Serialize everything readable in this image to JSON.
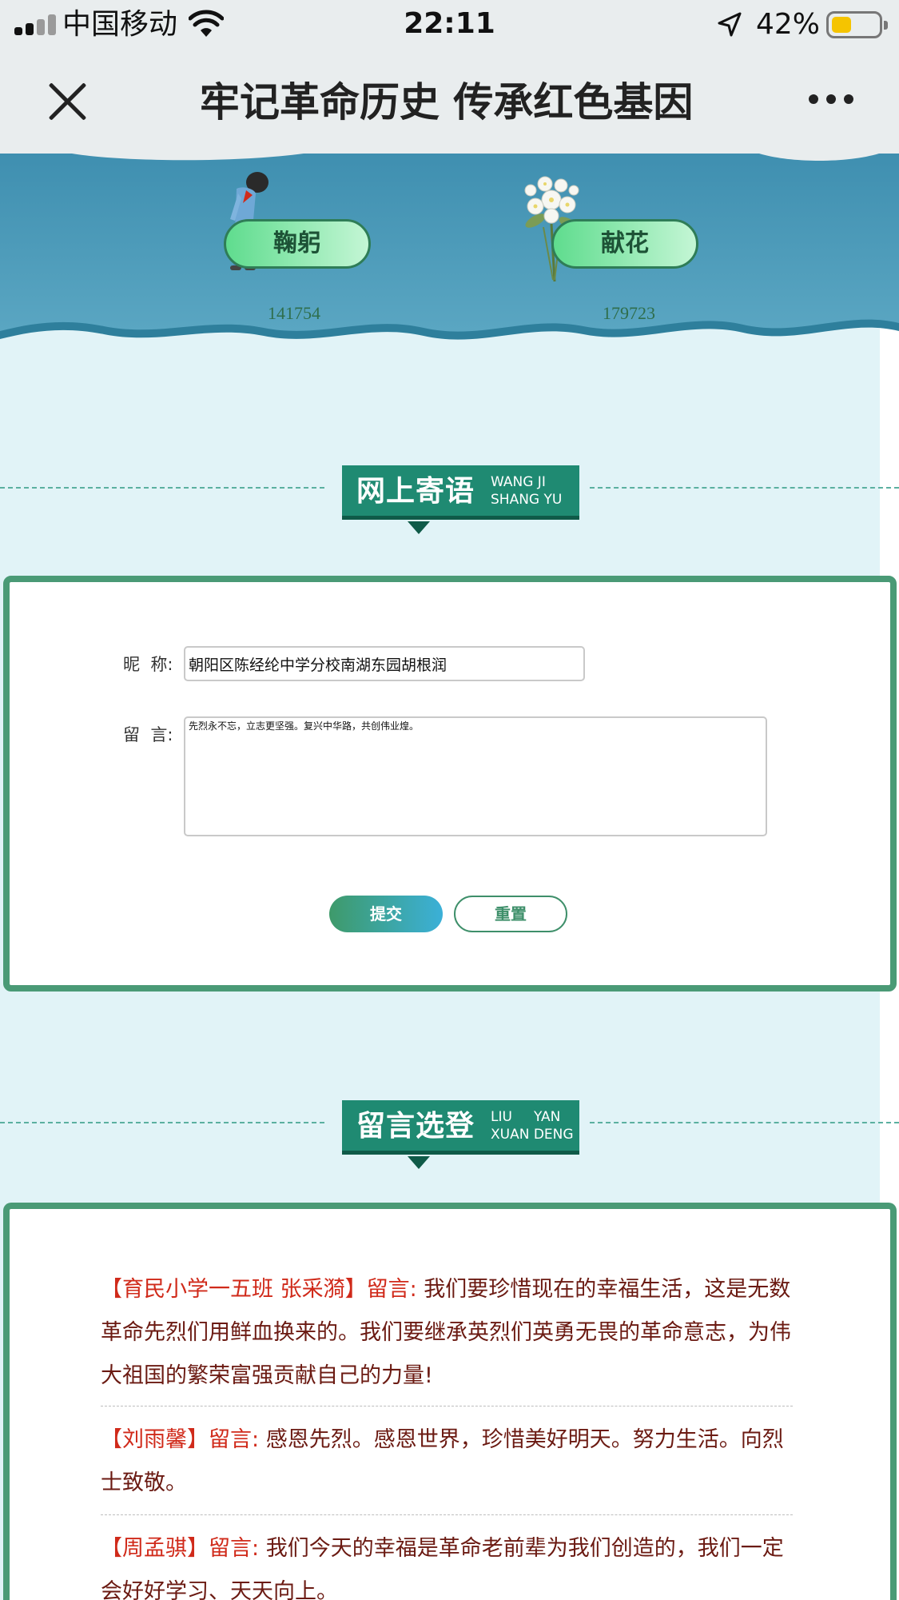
{
  "status_bar": {
    "carrier": "中国移动",
    "time": "22:11",
    "battery_percent": "42%",
    "battery_level": 0.42
  },
  "nav": {
    "title": "牢记革命历史 传承红色基因"
  },
  "memorial": {
    "bow": {
      "label": "鞠躬",
      "count": "141754"
    },
    "flower": {
      "label": "献花",
      "count": "179723"
    }
  },
  "guestbook_header": {
    "title_cn": "网上寄语",
    "pinyin_line1": "WANG JI",
    "pinyin_line2": "SHANG YU"
  },
  "form": {
    "nickname_label": "昵  称:",
    "nickname_value": "朝阳区陈经纶中学分校南湖东园胡根润",
    "message_label": "留  言:",
    "message_value": "先烈永不忘，立志更坚强。复兴中华路，共创伟业煌。",
    "submit_label": "提交",
    "reset_label": "重置"
  },
  "selected_header": {
    "title_cn": "留言选登",
    "pinyin_line1": "LIU     YAN",
    "pinyin_line2": "XUAN DENG"
  },
  "messages": [
    {
      "author": "【育民小学一五班 张采漪】留言:",
      "text": " 我们要珍惜现在的幸福生活，这是无数革命先烈们用鲜血换来的。我们要继承英烈们英勇无畏的革命意志，为伟大祖国的繁荣富强贡献自己的力量!"
    },
    {
      "author": "【刘雨馨】留言:",
      "text": " 感恩先烈。感恩世界，珍惜美好明天。努力生活。向烈士致敬。"
    },
    {
      "author": "【周孟骐】留言:",
      "text": " 我们今天的幸福是革命老前辈为我们创造的，我们一定会好好学习、天天向上。"
    }
  ],
  "icons": {
    "signal": "signal-bars-icon",
    "wifi": "wifi-icon",
    "location": "location-arrow-icon",
    "battery": "battery-icon",
    "close": "close-icon",
    "more": "more-dots-icon",
    "bow_figure": "bowing-student-icon",
    "flower": "white-flower-bouquet-icon"
  },
  "colors": {
    "banner_green": "#1f8a72",
    "card_border": "#4a9a76",
    "author_red": "#d02a1a",
    "message_text": "#6b1a12",
    "content_bg": "#e1f3f7",
    "wave_blue": "#4e9ab8"
  }
}
